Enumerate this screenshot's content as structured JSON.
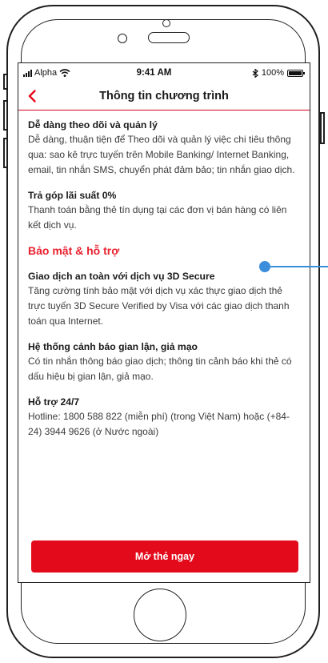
{
  "status": {
    "carrier": "Alpha",
    "time": "9:41 AM",
    "battery": "100%"
  },
  "nav": {
    "title": "Thông tin chương trình"
  },
  "features": [
    {
      "title": "Dễ dàng theo dõi và quản lý",
      "body": "Dễ dàng, thuận tiện để Theo dõi và quản lý việc chi tiêu thông qua: sao kê trực tuyến trên Mobile Banking/ Internet Banking, email, tin nhắn SMS, chuyển phát đảm bảo; tin nhắn giao dịch."
    },
    {
      "title": "Trả góp lãi suất 0%",
      "body": "Thanh toán bằng thẻ tín dụng tại các đơn vị bán hàng có liên kết dịch vụ."
    }
  ],
  "security": {
    "heading": "Bảo mật & hỗ trợ",
    "items": [
      {
        "title": "Giao dịch an toàn với dịch vụ 3D Secure",
        "body": "Tăng cường tính bảo mật với dịch vụ xác thực giao dịch thẻ trực tuyến 3D Secure Verified by Visa với các giao dịch thanh toán qua Internet."
      },
      {
        "title": "Hệ thống cảnh báo gian lận, giả mạo",
        "body": "Có tin nhắn thông báo giao dịch; thông tin cảnh báo khi thẻ có dấu hiệu bị gian lận, giả mạo."
      },
      {
        "title": "Hỗ trợ 24/7",
        "body": "Hotline: 1800 588 822 (miễn phí) (trong Việt Nam) hoặc (+84-24) 3944 9626 (ở Nước ngoài)"
      }
    ]
  },
  "cta": {
    "label": "Mở thẻ ngay"
  },
  "colors": {
    "accent": "#e30a1b",
    "annotation": "#3b8edb"
  }
}
